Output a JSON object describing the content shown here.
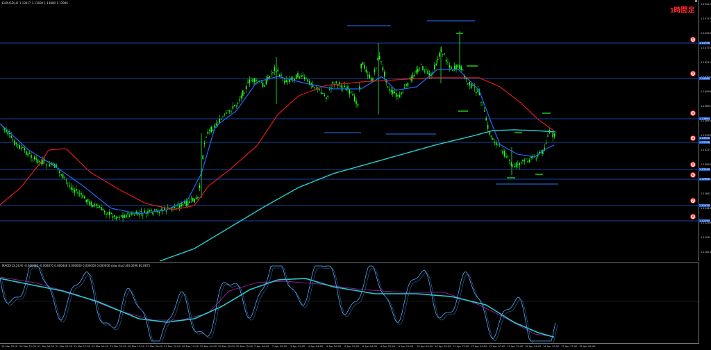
{
  "header": {
    "symbol_info": "EURUSD,H1  1.13917 1.13930 1.13880 1.13906",
    "timeframe_label": "1時間足"
  },
  "macd_info": "MACD(12,26,9) -0.000482 -0.000870 0.000448 0.000000 0.000000 0.000000  slow stoch 84.0296 80.8671",
  "price_axis": [
    "1.15222",
    "1.15113",
    "1.14926",
    "1.14720",
    "1.14512",
    "1.14305",
    "1.14098",
    "1.13892",
    "1.13685",
    "1.13478",
    "1.13271",
    "1.13065",
    "1.12858",
    "1.12651",
    "1.12444",
    "1.12238",
    "1.12031",
    "1.11824"
  ],
  "price_tags": [
    "1.14766",
    "1.14366",
    "1.13880",
    "1.13906",
    "1.13766",
    "1.13246",
    "1.12986",
    "1.12476",
    "1.12290"
  ],
  "time_axis": [
    "19 Mar 2018",
    "20 Mar 12:00",
    "21 Mar 04:00",
    "21 Mar 20:00",
    "22 Mar 12:00",
    "23 Mar 04:00",
    "23 Mar 20:00",
    "26 Mar 12:00",
    "27 Mar 04:00",
    "27 Mar 20:00",
    "28 Mar 12:00",
    "29 Mar 04:00",
    "29 Mar 20:00",
    "30 Mar 12:00",
    "2 Apr 04:00",
    "2 Apr 20:00",
    "3 Apr 12:00",
    "4 Apr 04:00",
    "4 Apr 20:00",
    "5 Apr 12:00",
    "6 Apr 04:00",
    "6 Apr 20:00",
    "9 Apr 12:00",
    "10 Apr 04:00",
    "10 Apr 20:00",
    "11 Apr 12:00",
    "12 Apr 04:00",
    "12 Apr 20:00",
    "13 Apr 12:00",
    "16 Apr 04:00",
    "16 Apr 20:00",
    "17 Apr 12:00",
    "18 Apr 04:00"
  ],
  "badges": [
    "①",
    "②",
    "③",
    "④",
    "⑤",
    "⑥",
    "⑦",
    "⑧"
  ],
  "colors": {
    "candle": "#22ff22",
    "ma_fast": "#1e6bff",
    "ma_mid": "#e0191c",
    "ma_slow": "#22d0d0",
    "hline": "#1e5fd0",
    "level": "#1e5fd0",
    "macd_main": "#22d0d0",
    "macd_signal": "#b020b0",
    "stoch_main": "#5aa8ff"
  }
}
